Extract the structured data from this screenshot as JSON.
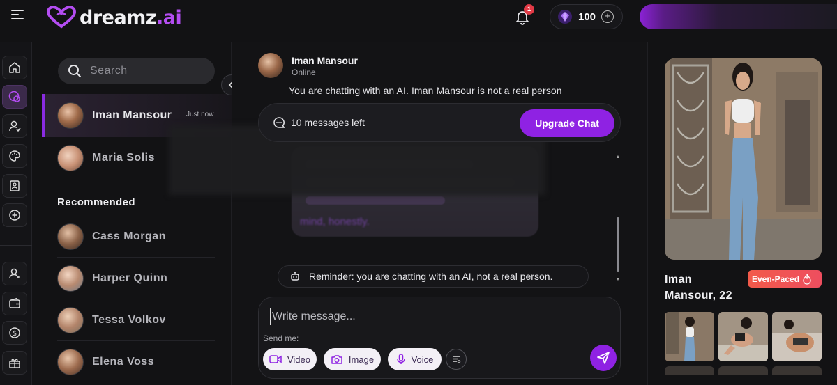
{
  "brand": {
    "logo_name": "dreamz",
    "logo_ai": ".ai"
  },
  "header": {
    "notification_count": "1",
    "gems": "100",
    "gem_plus": "+"
  },
  "rail": {
    "items": [
      "home-icon",
      "chat-icon",
      "character-icon",
      "palette-icon",
      "gallery-icon",
      "add-icon",
      "profile-icon",
      "wallet-icon",
      "coin-icon",
      "gift-icon"
    ]
  },
  "chatlist": {
    "search_placeholder": "Search",
    "chats": [
      {
        "name": "Iman Mansour",
        "time": "Just now"
      },
      {
        "name": "Maria Solis",
        "time": ""
      }
    ],
    "recommended_title": "Recommended",
    "recommended": [
      {
        "name": "Cass Morgan"
      },
      {
        "name": "Harper Quinn"
      },
      {
        "name": "Tessa Volkov"
      },
      {
        "name": "Elena Voss"
      }
    ]
  },
  "chat": {
    "name": "Iman Mansour",
    "status": "Online",
    "disclaimer": "You are chatting with an AI. Iman Mansour is not a real person",
    "messages_left": "10 messages left",
    "upgrade_label": "Upgrade Chat",
    "blurred_message": "mind, honestly.",
    "reminder": "Reminder: you are chatting with an AI, not a real person.",
    "input_placeholder": "Write message...",
    "send_me_label": "Send me:",
    "media_options": [
      "Video",
      "Image",
      "Voice"
    ]
  },
  "profile": {
    "name_line1": "Iman",
    "name_line2": "Mansour, 22",
    "badge": "Even-Paced"
  },
  "colors": {
    "accent": "#8f22e3",
    "background": "#121214",
    "badge": "#f25a4a"
  }
}
